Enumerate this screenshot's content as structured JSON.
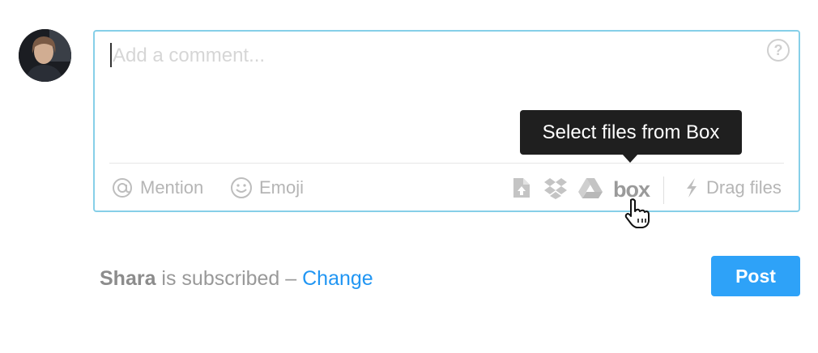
{
  "user": {
    "avatar_icon": "user-avatar"
  },
  "composer": {
    "placeholder": "Add a comment...",
    "value": "",
    "help_icon": "question-circle-icon",
    "help_glyph": "?",
    "border_color": "#86cfe8"
  },
  "toolbar": {
    "mention_label": "Mention",
    "emoji_label": "Emoji",
    "attach_icons": [
      "upload-file-icon",
      "dropbox-icon",
      "google-drive-icon"
    ],
    "box_label": "box",
    "drag_files_label": "Drag files"
  },
  "tooltip": {
    "text": "Select files from Box"
  },
  "subscription": {
    "name": "Shara",
    "text": " is subscribed – ",
    "change_label": "Change",
    "link_color": "#2196f3"
  },
  "post_button": {
    "label": "Post",
    "color": "#2ea2f8"
  }
}
